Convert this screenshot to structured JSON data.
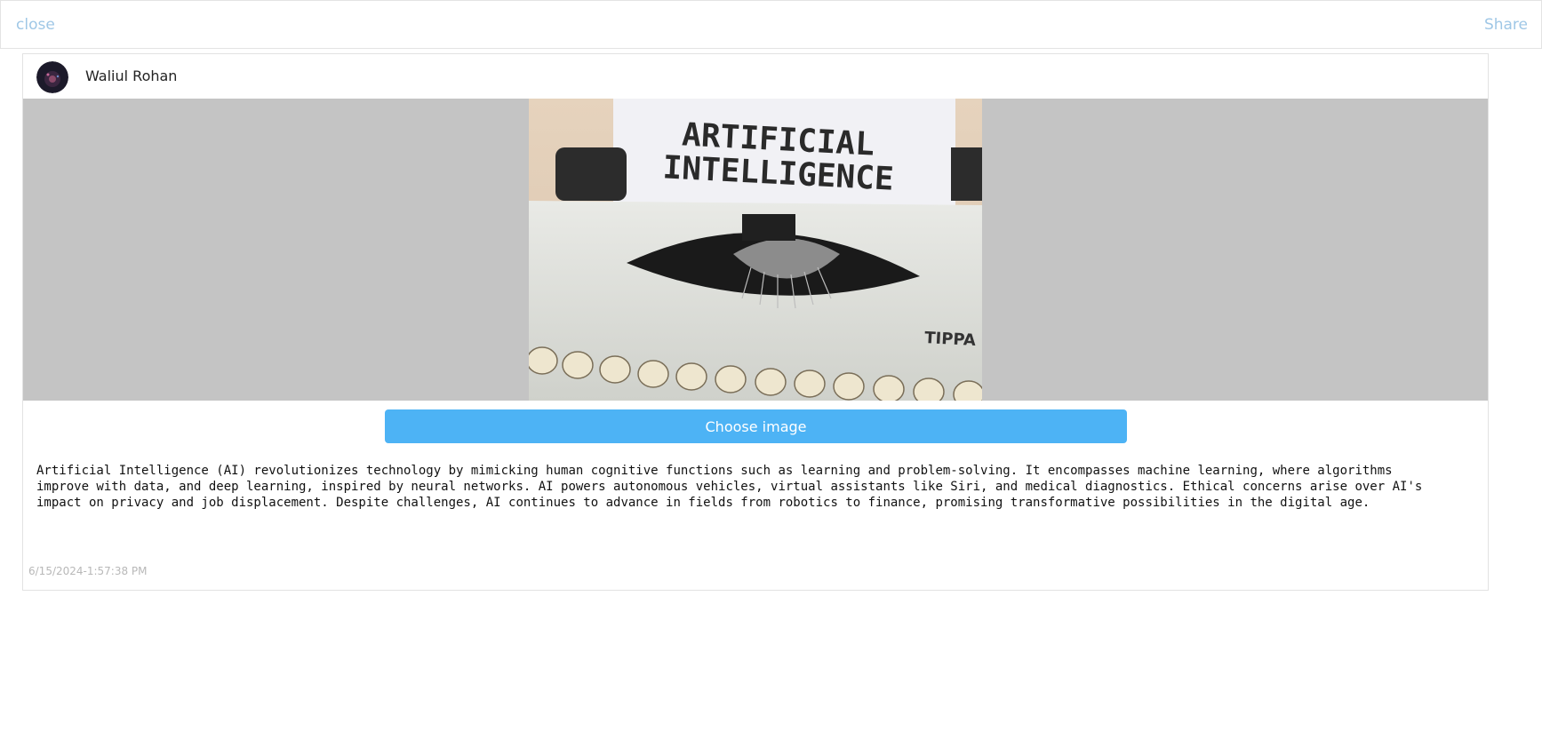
{
  "topbar": {
    "close_label": "close",
    "share_label": "Share"
  },
  "post": {
    "author": "Waliul Rohan",
    "image_alt": "ARTIFICIAL INTELLIGENCE typewriter photo",
    "image_text_line1": "ARTIFICIAL",
    "image_text_line2": "INTELLIGENCE",
    "typewriter_brand": "TIPPA",
    "choose_image_label": "Choose image",
    "body": "Artificial Intelligence (AI) revolutionizes technology by mimicking human cognitive functions such as learning and problem-solving. It encompasses machine learning, where algorithms improve with data, and deep learning, inspired by neural networks. AI powers autonomous vehicles, virtual assistants like Siri, and medical diagnostics. Ethical concerns arise over AI's impact on privacy and job displacement. Despite challenges, AI continues to advance in fields from robotics to finance, promising transformative possibilities in the digital age.",
    "timestamp": "6/15/2024-1:57:38 PM"
  },
  "colors": {
    "accent": "#4db3f5",
    "link": "#9fc7e6",
    "image_backdrop": "#c4c4c4"
  }
}
